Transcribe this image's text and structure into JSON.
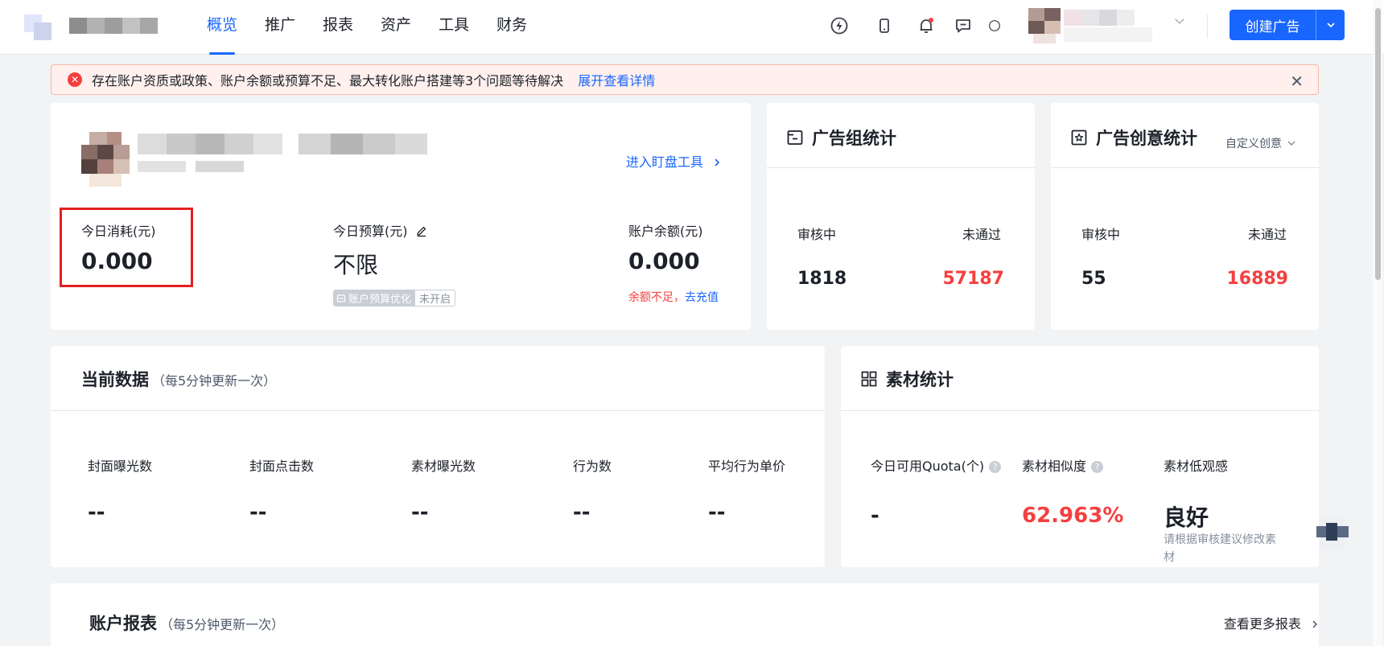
{
  "nav": {
    "items": [
      {
        "label": "概览",
        "active": true
      },
      {
        "label": "推广"
      },
      {
        "label": "报表"
      },
      {
        "label": "资产"
      },
      {
        "label": "工具"
      },
      {
        "label": "财务"
      }
    ]
  },
  "header": {
    "create_button_label": "创建广告",
    "icons": [
      "lightning-icon",
      "phone-icon",
      "bell-icon",
      "message-icon",
      "help-icon"
    ]
  },
  "alert": {
    "text": "存在账户资质或政策、账户余额或预算不足、最大转化账户搭建等3个问题等待解决",
    "link": "展开查看详情"
  },
  "account": {
    "enter_tool": "进入盯盘工具",
    "today_spend_label": "今日消耗(元)",
    "today_spend_value": "0.000",
    "today_budget_label": "今日预算(元)",
    "today_budget_value": "不限",
    "budget_opt_label": "账户预算优化",
    "budget_opt_status": "未开启",
    "balance_label": "账户余额(元)",
    "balance_value": "0.000",
    "low_balance_text": "余额不足，",
    "recharge_link": "去充值"
  },
  "ad_group_stats": {
    "title": "广告组统计",
    "reviewing_label": "审核中",
    "reviewing_value": "1818",
    "rejected_label": "未通过",
    "rejected_value": "57187"
  },
  "creative_stats": {
    "title": "广告创意统计",
    "dropdown": "自定义创意",
    "reviewing_label": "审核中",
    "reviewing_value": "55",
    "rejected_label": "未通过",
    "rejected_value": "16889"
  },
  "current_data": {
    "title": "当前数据",
    "note": "（每5分钟更新一次）",
    "metrics": [
      {
        "label": "封面曝光数",
        "value": "--"
      },
      {
        "label": "封面点击数",
        "value": "--"
      },
      {
        "label": "素材曝光数",
        "value": "--"
      },
      {
        "label": "行为数",
        "value": "--"
      },
      {
        "label": "平均行为单价",
        "value": "--"
      }
    ]
  },
  "material_stats": {
    "title": "素材统计",
    "quota_label": "今日可用Quota(个)",
    "quota_value": "-",
    "similarity_label": "素材相似度",
    "similarity_value": "62.963%",
    "low_view_label": "素材低观感",
    "low_view_value": "良好",
    "low_view_hint": "请根据审核建议修改素材"
  },
  "report": {
    "title": "账户报表",
    "note": "（每5分钟更新一次）",
    "more_link": "查看更多报表"
  },
  "colors": {
    "accent": "#1966ff",
    "danger": "#f53f3f",
    "highlight_box": "#e41f1f"
  }
}
